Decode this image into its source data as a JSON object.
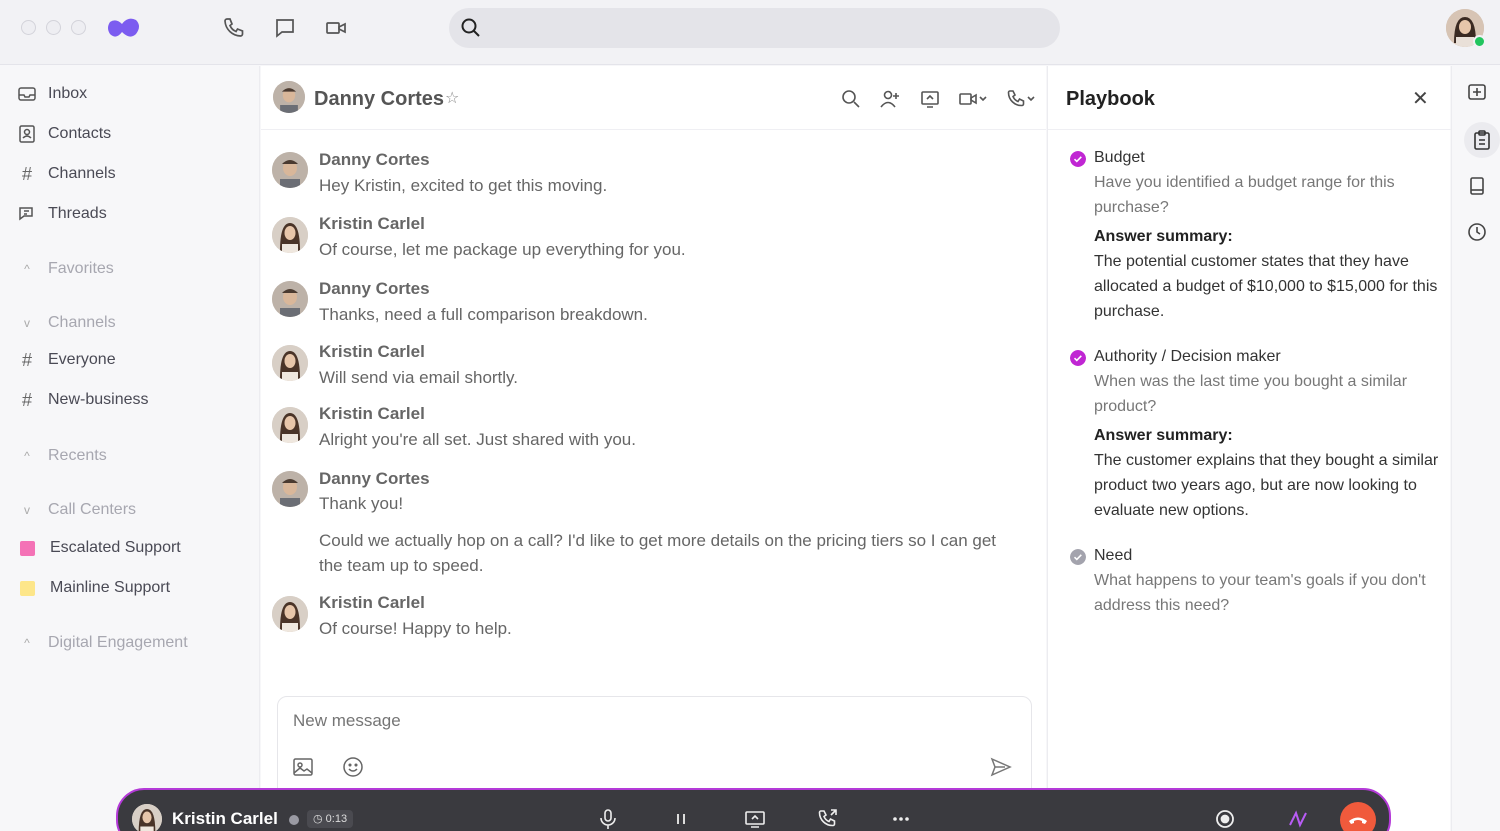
{
  "topbar": {
    "search_placeholder": ""
  },
  "sidebar": {
    "items": [
      {
        "label": "Inbox",
        "icon": "inbox-icon"
      },
      {
        "label": "Contacts",
        "icon": "contacts-icon"
      },
      {
        "label": "Channels",
        "icon": "hash-icon"
      },
      {
        "label": "Threads",
        "icon": "threads-icon"
      }
    ],
    "favorites": "Favorites",
    "channels_section": "Channels",
    "channels": [
      "Everyone",
      "New-business"
    ],
    "recents": "Recents",
    "call_centers": "Call Centers",
    "call_center_items": [
      {
        "label": "Escalated Support",
        "color": "#f472b6"
      },
      {
        "label": "Mainline Support",
        "color": "#fde68a"
      }
    ],
    "digital_engagement": "Digital Engagement"
  },
  "chat": {
    "contact_name": "Danny Cortes",
    "messages": [
      {
        "name": "Danny Cortes",
        "text": "Hey Kristin, excited to get this moving."
      },
      {
        "name": "Kristin Carlel",
        "text": "Of course, let me package up everything for you."
      },
      {
        "name": "Danny Cortes",
        "text": "Thanks, need a full comparison breakdown."
      },
      {
        "name": "Kristin Carlel",
        "text": "Will send via email shortly."
      },
      {
        "name": "Kristin Carlel",
        "text": "Alright you're all set. Just shared with you."
      },
      {
        "name": "Danny Cortes",
        "text": "Thank you!",
        "followup": "Could we actually hop on a call? I'd like to get more details on the pricing tiers so I can get the team up to speed."
      },
      {
        "name": "Kristin Carlel",
        "text": "Of course! Happy to help."
      }
    ],
    "composer_placeholder": "New message"
  },
  "playbook": {
    "title": "Playbook",
    "items": [
      {
        "heading": "Budget",
        "question": "Have you identified a budget range for this purchase?",
        "answer_label": "Answer summary:",
        "answer": "The potential customer states that they have allocated a budget of $10,000 to $15,000 for this purchase.",
        "status_color": "#c026d3"
      },
      {
        "heading": "Authority / Decision maker",
        "question": "When was the last time you bought a similar product?",
        "answer_label": "Answer summary:",
        "answer": "The customer explains that they bought a similar product two years ago, but are now looking to evaluate new options.",
        "status_color": "#c026d3"
      },
      {
        "heading": "Need",
        "question": "What happens to your team's goals if you don't address this need?",
        "status_color": "#9ca3af"
      }
    ]
  },
  "callbar": {
    "name": "Kristin Carlel",
    "timer": "0:13"
  }
}
